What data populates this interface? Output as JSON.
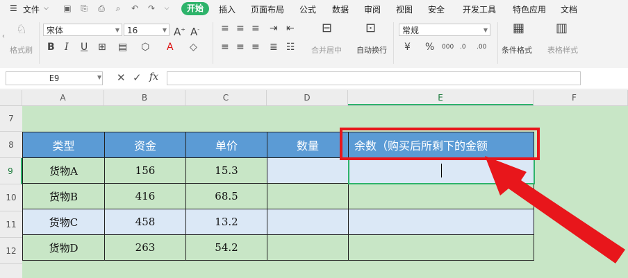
{
  "menu": {
    "file": "文件",
    "tabs": [
      "插入",
      "页面布局",
      "公式",
      "数据",
      "审阅",
      "视图",
      "安全",
      "开发工具",
      "特色应用",
      "文档"
    ],
    "active_tab": "开始"
  },
  "ribbon": {
    "format_painter": "格式刷",
    "font_name": "宋体",
    "font_size": "16",
    "merge_center": "合并居中",
    "wrap_text": "自动换行",
    "number_format": "常规",
    "conditional_format": "条件格式",
    "table_style": "表格样式"
  },
  "formula_bar": {
    "cell_ref": "E9",
    "fx": "fx",
    "content": ""
  },
  "columns": [
    "A",
    "B",
    "C",
    "D",
    "E",
    "F"
  ],
  "rows": [
    "7",
    "8",
    "9",
    "10",
    "11",
    "12"
  ],
  "table": {
    "headers": [
      "类型",
      "资金",
      "单价",
      "数量",
      "余数（购买后所剩下的金额"
    ],
    "rows": [
      [
        "货物A",
        "156",
        "15.3",
        "",
        ""
      ],
      [
        "货物B",
        "416",
        "68.5",
        "",
        ""
      ],
      [
        "货物C",
        "458",
        "13.2",
        "",
        ""
      ],
      [
        "货物D",
        "263",
        "54.2",
        "",
        ""
      ]
    ]
  },
  "colors": {
    "accent": "#2db36a",
    "header_fill": "#5b9bd5",
    "highlight": "#e8161b",
    "sheet_green": "#c8e6c6",
    "row_blue": "#dbe8f6"
  }
}
